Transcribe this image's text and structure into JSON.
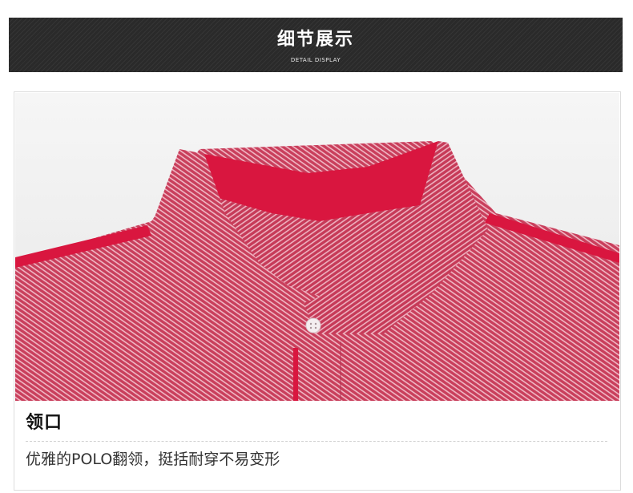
{
  "header": {
    "title": "细节展示",
    "subtitle": "DETAIL DISPLAY",
    "background_color": "#2a2a2a"
  },
  "photo": {
    "subject": "red-polo-collar-detail",
    "fabric_color": "#cc4560",
    "trim_color": "#d9163f"
  },
  "caption": {
    "title": "领口",
    "text": "优雅的POLO翻领，挺括耐穿不易变形"
  }
}
